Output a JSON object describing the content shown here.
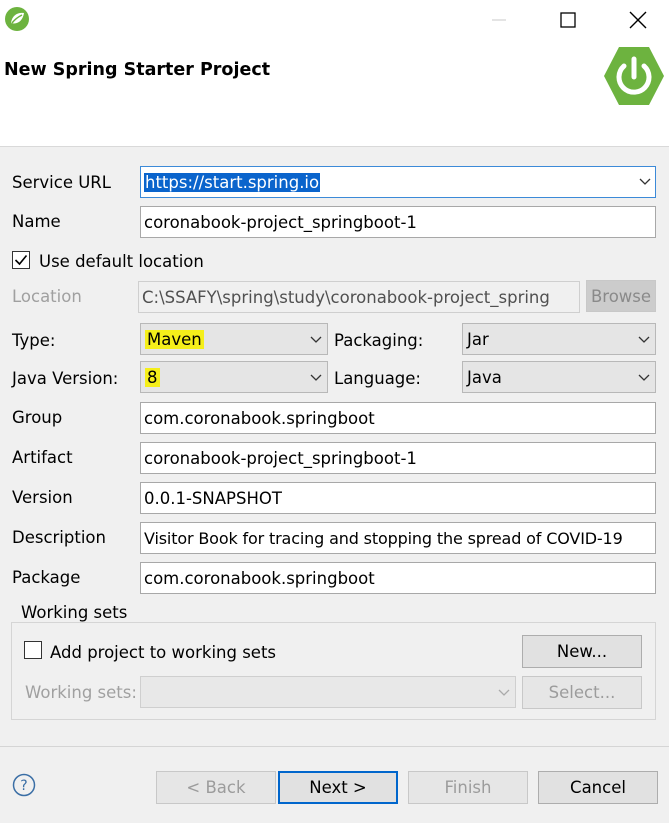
{
  "header": {
    "title": "New Spring Starter Project"
  },
  "form": {
    "service_url": {
      "label": "Service URL",
      "value": "https://start.spring.io"
    },
    "name": {
      "label": "Name",
      "value": "coronabook-project_springboot-1"
    },
    "use_default_location": {
      "label": "Use default location",
      "checked": true
    },
    "location": {
      "label": "Location",
      "value": "C:\\SSAFY\\spring\\study\\coronabook-project_spring",
      "browse_label": "Browse"
    },
    "type": {
      "label": "Type:",
      "value": "Maven"
    },
    "packaging": {
      "label": "Packaging:",
      "value": "Jar"
    },
    "java_version": {
      "label": "Java Version:",
      "value": "8"
    },
    "language": {
      "label": "Language:",
      "value": "Java"
    },
    "group": {
      "label": "Group",
      "value": "com.coronabook.springboot"
    },
    "artifact": {
      "label": "Artifact",
      "value": "coronabook-project_springboot-1"
    },
    "version": {
      "label": "Version",
      "value": "0.0.1-SNAPSHOT"
    },
    "description": {
      "label": "Description",
      "value": "Visitor Book for tracing and stopping the spread of COVID-19"
    },
    "package": {
      "label": "Package",
      "value": "com.coronabook.springboot"
    }
  },
  "working_sets": {
    "title": "Working sets",
    "add_label": "Add project to working sets",
    "add_checked": false,
    "new_label": "New...",
    "sets_label": "Working sets:",
    "select_label": "Select..."
  },
  "footer": {
    "help_label": "?",
    "back_label": "< Back",
    "next_label": "Next >",
    "finish_label": "Finish",
    "cancel_label": "Cancel"
  },
  "colors": {
    "spring_green": "#6db33f",
    "highlight": "#f5ef1a",
    "selection": "#0a64cc",
    "focus_border": "#0066cc"
  },
  "icons": [
    "spring-app-icon",
    "minimize-icon",
    "maximize-icon",
    "close-icon",
    "spring-power-logo",
    "chevron-down-icon",
    "checkmark-icon",
    "help-icon"
  ]
}
